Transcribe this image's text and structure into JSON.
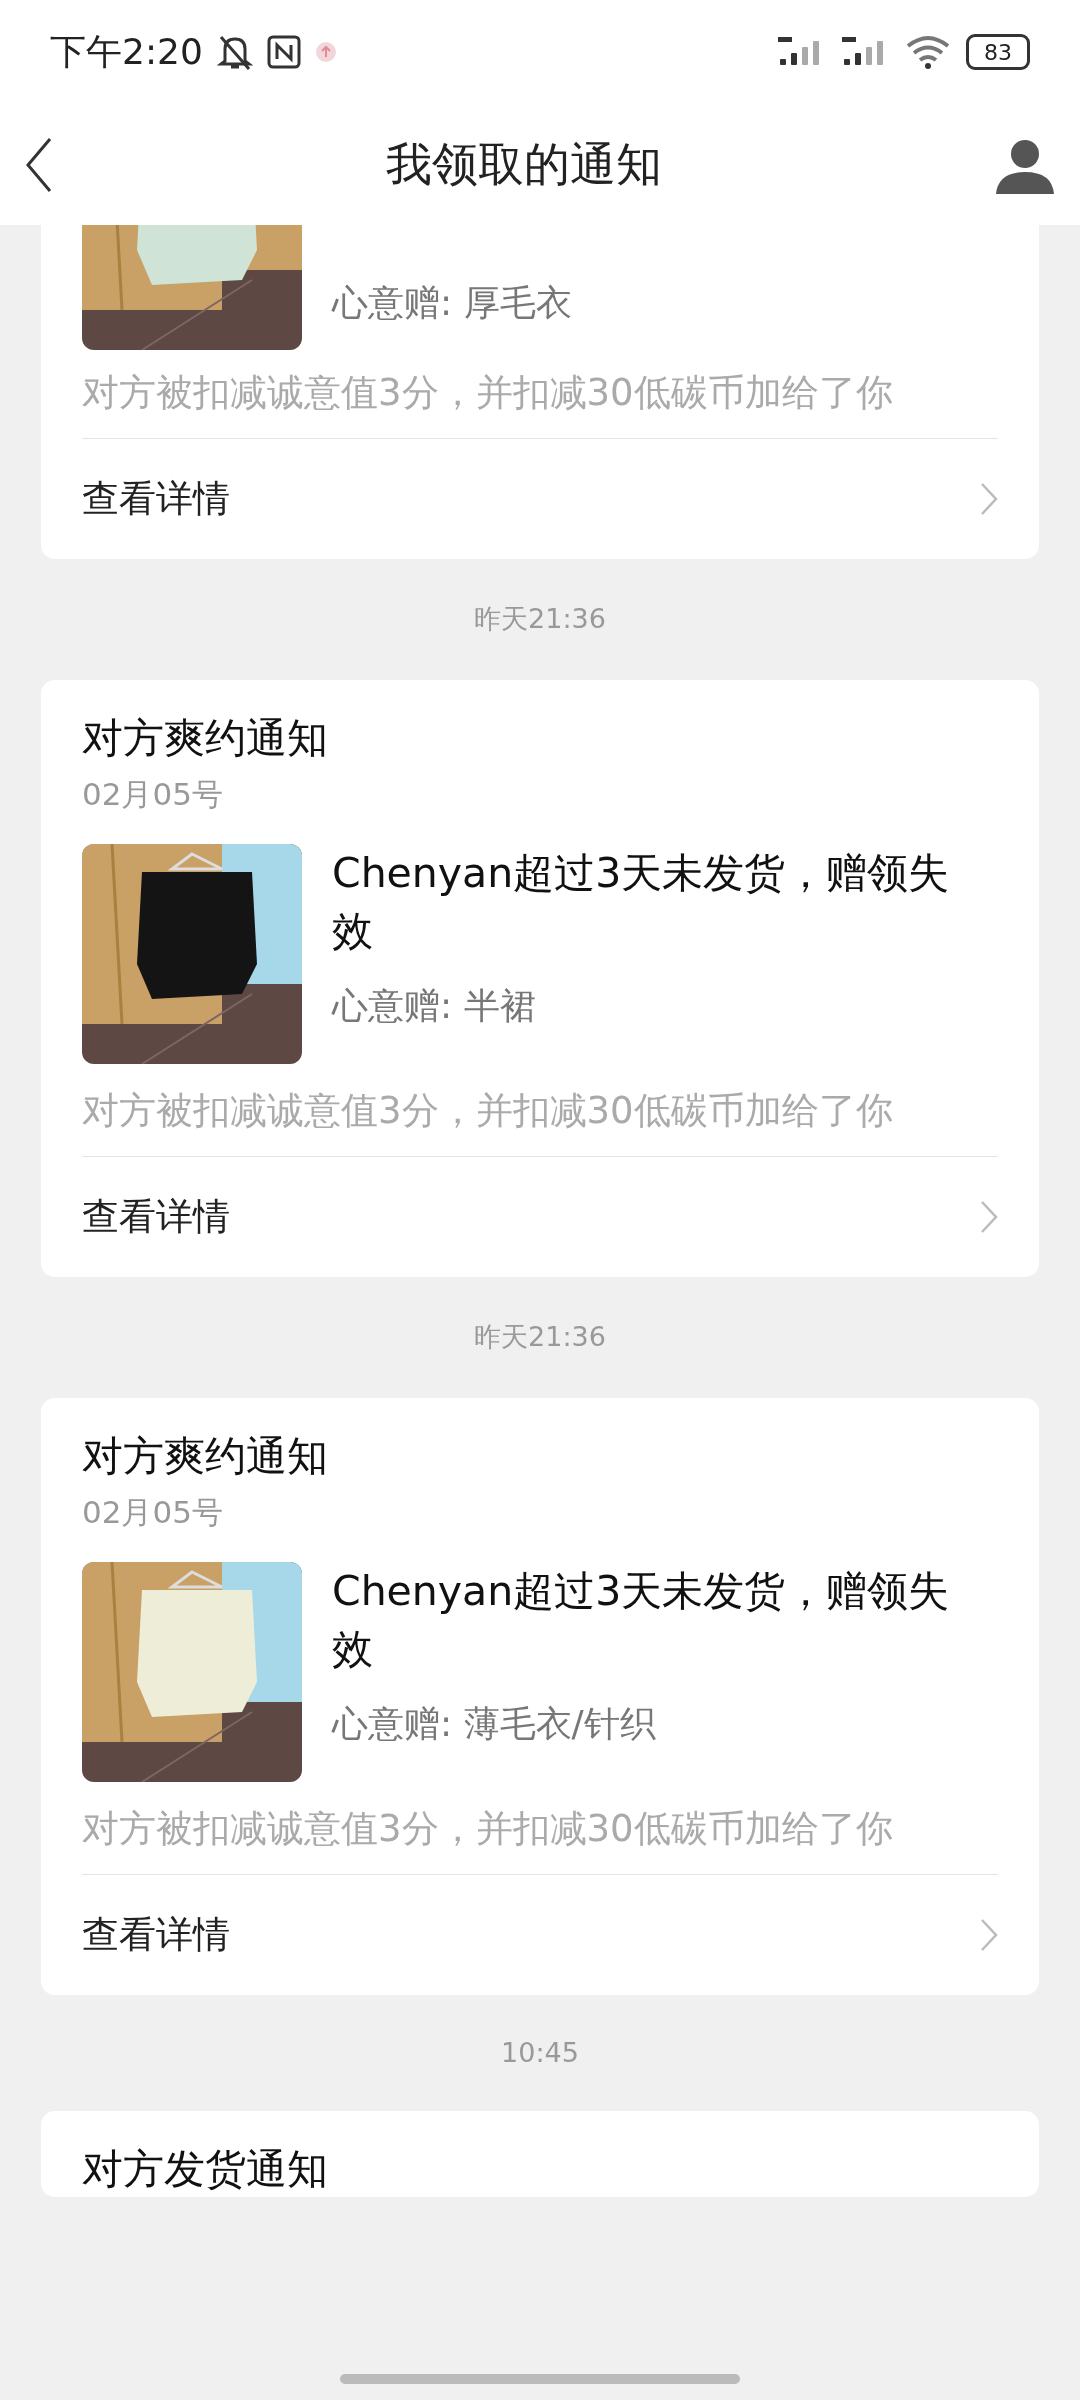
{
  "status_bar": {
    "time": "下午2:20",
    "battery": "83"
  },
  "header": {
    "title": "我领取的通知"
  },
  "feed": [
    {
      "kind": "card",
      "partial": true,
      "gift": "心意赠: 厚毛衣",
      "note": "对方被扣减诚意值3分，并扣减30低碳币加给了你",
      "link": "查看详情"
    },
    {
      "kind": "time",
      "text": "昨天21:36"
    },
    {
      "kind": "card",
      "title": "对方爽约通知",
      "date": "02月05号",
      "message": "Chenyan超过3天未发货，赠领失效",
      "gift": "心意赠: 半裙",
      "note": "对方被扣减诚意值3分，并扣减30低碳币加给了你",
      "link": "查看详情"
    },
    {
      "kind": "time",
      "text": "昨天21:36"
    },
    {
      "kind": "card",
      "title": "对方爽约通知",
      "date": "02月05号",
      "message": "Chenyan超过3天未发货，赠领失效",
      "gift": "心意赠: 薄毛衣/针织",
      "note": "对方被扣减诚意值3分，并扣减30低碳币加给了你",
      "link": "查看详情"
    },
    {
      "kind": "time",
      "text": "10:45"
    },
    {
      "kind": "card",
      "title": "对方发货通知"
    }
  ]
}
